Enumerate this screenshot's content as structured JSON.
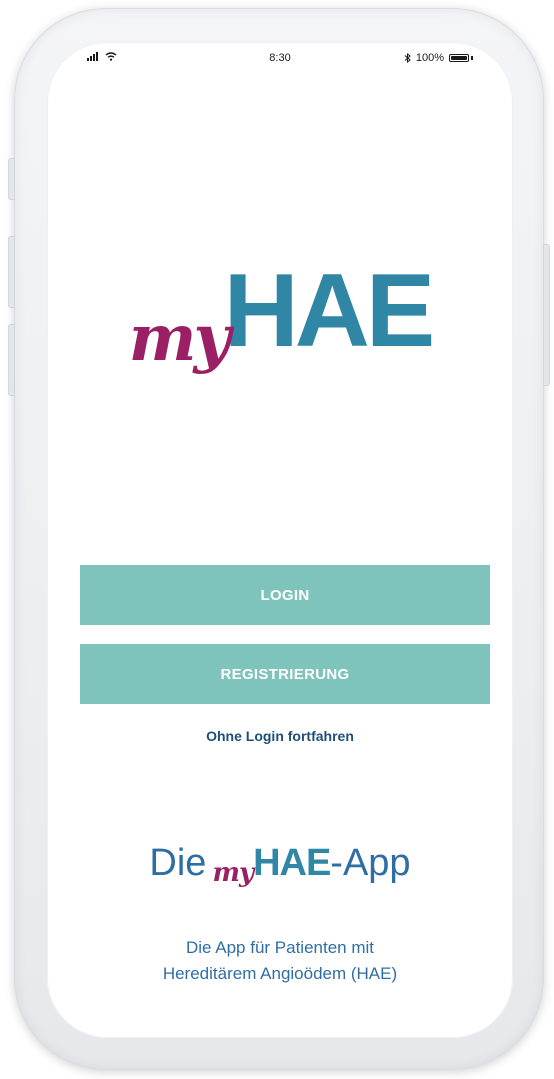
{
  "status_bar": {
    "time": "8:30",
    "battery": "100%",
    "bluetooth_icon": "bluetooth-icon",
    "signal_icon": "signal-icon",
    "wifi_icon": "wifi-icon"
  },
  "logo": {
    "my": "my",
    "hae": "HAE"
  },
  "actions": {
    "login_label": "LOGIN",
    "register_label": "REGISTRIERUNG",
    "skip_label": "Ohne Login fortfahren"
  },
  "tagline": {
    "prefix": "Die",
    "my": "my",
    "hae": "HAE",
    "suffix": "-App",
    "subtitle_line1": "Die App für Patienten mit",
    "subtitle_line2": "Hereditärem Angioödem (HAE)"
  },
  "colors": {
    "brand_magenta": "#9b1f64",
    "brand_blue": "#2f86a5",
    "button_teal": "#7fc3bd",
    "link_navy": "#1f4e79"
  }
}
